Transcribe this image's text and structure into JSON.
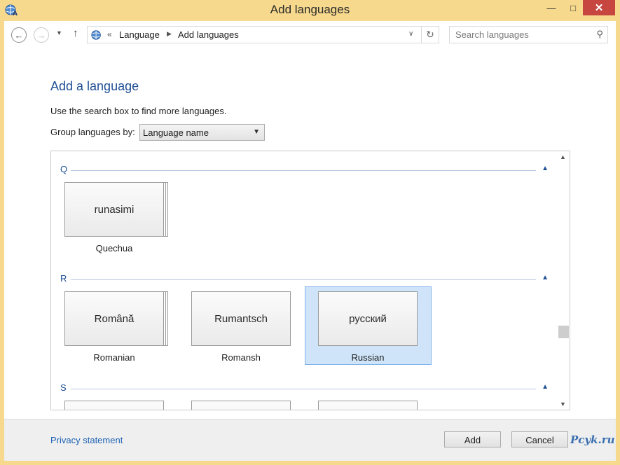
{
  "window": {
    "title": "Add languages"
  },
  "nav": {
    "breadcrumb": [
      "Language",
      "Add languages"
    ],
    "overflow": "«",
    "search_placeholder": "Search languages"
  },
  "main": {
    "heading": "Add a language",
    "hint": "Use the search box to find more languages.",
    "group_by_label": "Group languages by:",
    "group_by_value": "Language name"
  },
  "groups": [
    {
      "letter": "Q",
      "tiles": [
        {
          "native": "runasimi",
          "name": "Quechua",
          "selected": false
        }
      ]
    },
    {
      "letter": "R",
      "tiles": [
        {
          "native": "Română",
          "name": "Romanian",
          "selected": false
        },
        {
          "native": "Rumantsch",
          "name": "Romansh",
          "selected": false
        },
        {
          "native": "русский",
          "name": "Russian",
          "selected": true
        }
      ]
    },
    {
      "letter": "S",
      "tiles": []
    }
  ],
  "footer": {
    "privacy": "Privacy statement",
    "add": "Add",
    "cancel": "Cancel",
    "watermark": "Pcyk.ru"
  },
  "colors": {
    "accent": "#1f4f94",
    "titlebar": "#f6d98c",
    "selection": "#cfe4f8",
    "close": "#c7463f"
  }
}
